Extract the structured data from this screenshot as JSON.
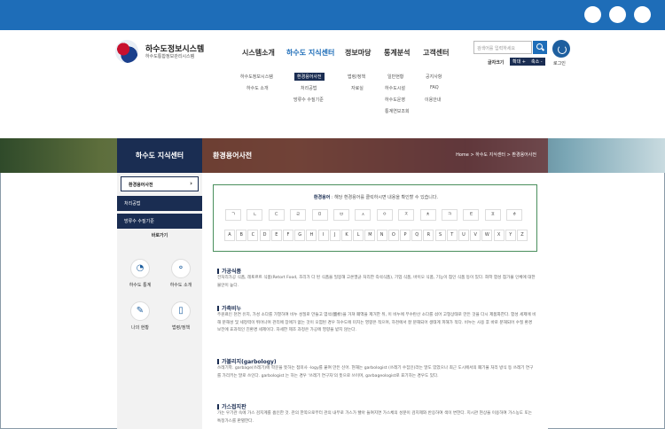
{
  "site": {
    "title": "하수도정보시스템",
    "subtitle": "하수도통합정보관리시스템"
  },
  "gnb": [
    "시스템소개",
    "하수도 지식센터",
    "정보마당",
    "통계분석",
    "고객센터"
  ],
  "sub_menus": {
    "col1": [
      "하수도정보시스템",
      "하수도 소개"
    ],
    "col2": [
      "환경용어사전",
      "처리공법",
      "방류수 수질기준"
    ],
    "col3": [
      "법령/정책",
      "자료실"
    ],
    "col4": [
      "일반현황",
      "하수도시설",
      "하수도운영",
      "통계연보조회"
    ],
    "col5": [
      "공지사항",
      "FAQ",
      "이용안내"
    ]
  },
  "search": {
    "placeholder": "검색어를 입력하세요"
  },
  "font": {
    "label": "글자크기",
    "up": "확대 +",
    "down": "축소 -"
  },
  "login_label": "로그인",
  "hero": {
    "left_title": "하수도 지식센터",
    "page_title": "환경용어사전",
    "breadcrumb": "Home > 하수도 지식센터 > 환경용어사전"
  },
  "left_nav": [
    {
      "label": "환경용어사전",
      "chevron": "›"
    },
    {
      "label": "처리공법"
    },
    {
      "label": "방류수 수질기준"
    }
  ],
  "shortcut": {
    "title": "바로가기",
    "items": [
      {
        "label": "하수도 통계",
        "icon": "chart-icon",
        "glyph": "◔"
      },
      {
        "label": "하수도 소개",
        "icon": "bubbles-icon",
        "glyph": "⚬"
      },
      {
        "label": "나의 현황",
        "icon": "tools-icon",
        "glyph": "✎"
      },
      {
        "label": "법령/정책",
        "icon": "document-icon",
        "glyph": "▯"
      }
    ]
  },
  "dictionary": {
    "title_bold": "환경용어",
    "title_rest": " : 해당 환경용어를 클릭하시면 내용을 확인할 수 있습니다.",
    "korean": [
      "ㄱ",
      "ㄴ",
      "ㄷ",
      "ㄹ",
      "ㅁ",
      "ㅂ",
      "ㅅ",
      "ㅇ",
      "ㅈ",
      "ㅊ",
      "ㅋ",
      "ㅌ",
      "ㅍ",
      "ㅎ"
    ],
    "english": [
      "A",
      "B",
      "C",
      "D",
      "E",
      "F",
      "G",
      "H",
      "I",
      "J",
      "K",
      "L",
      "M",
      "N",
      "O",
      "P",
      "Q",
      "R",
      "S",
      "T",
      "U",
      "V",
      "W",
      "X",
      "Y",
      "Z"
    ]
  },
  "terms": [
    {
      "title": "가공식품",
      "desc": "전처리가공 식품, 레토르트 식품(Retort Food, 조리가 다 된 식품을 밀봉해 고온멸균 처리한 즉석식품), 기업 식품, 바이오 식품, 기능이 첨인 식품 등이 있다. 화학 합성 첨가물 인체에 대한 불안이 높다."
    },
    {
      "title": "가축비누",
      "desc": "주원료인 천연 유지, 가성 소다를 가열하여 비누 성질로 만들고 염석(鹽析)을 거쳐 폐액을 제거한 뒤, 이 비누에 무수탄산 소다를 섞어 고형상태로 만든 것을 다시 제품화한다. 합성 세제에 비해 분해성 및 세정력이 뛰어나며 관리에 장애가 없는 것이 오염된 경우 하수도에 미치는 영향은 적으며, 하천에서 잘 분해되어 생태계 피해가 적다. 비누는 사용 후 바로 분해되어 수질 환경 보전에 효과적인 친환경 세제이다. 자세한 제조 과정은 가공에 영향을 받지 않는다."
    },
    {
      "title": "가볼리지(garbology)",
      "desc": "쓰레기학. garbage(쓰레기)에 학문을 뜻하는 접미사 -logy를 붙여 만든 신어. 현재는 garbologist (쓰레기 수집인)라는 말도 있었으나 최근 도시에서의 폐기물 처리 방식 등 쓰레기 연구를 가리키는 말로 쓰인다. garbologist 는 하는 경우 '쓰레기 연구자'의 뜻으로 쓰이며, garbageologist로 표기하는 경우도 있다."
    },
    {
      "title": "가스접지판",
      "desc": "가는 우기관 속에 가스 검지계를 흡인한 것. 관의 한쪽으로부터 관의 내부로 가스가 빨아 들여지면 가스체의 성분이 검지제와 반응하여 색이 변한다. 지시관 현상을 이용하여 가스농도 또는 특정가스를 판별한다."
    }
  ]
}
